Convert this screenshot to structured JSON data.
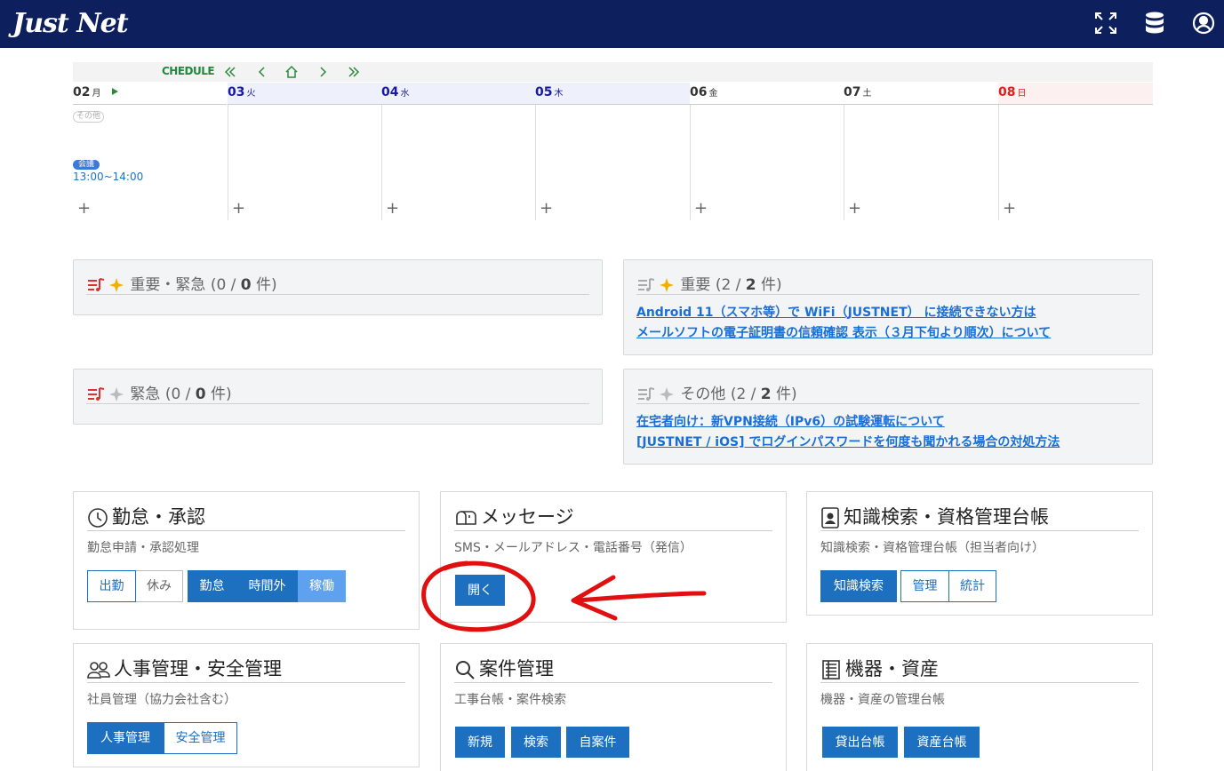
{
  "header": {
    "logo": "Just Net",
    "icons": [
      "fullscreen-icon",
      "database-icon",
      "user-icon"
    ],
    "bg_color": "#0e1f5e"
  },
  "schedule": {
    "title": "CHEDULE",
    "days": [
      {
        "date": "02",
        "dow": "月",
        "color": "#000"
      },
      {
        "date": "03",
        "dow": "火",
        "color": "#1a1aa0"
      },
      {
        "date": "04",
        "dow": "水",
        "color": "#1a1aa0"
      },
      {
        "date": "05",
        "dow": "木",
        "color": "#1a1aa0"
      },
      {
        "date": "06",
        "dow": "金",
        "color": "#000"
      },
      {
        "date": "07",
        "dow": "土",
        "color": "#000"
      },
      {
        "date": "08",
        "dow": "日",
        "color": "#e02020"
      }
    ],
    "other_badge": "その他",
    "meeting_badge": "会議",
    "meeting_time": "13:00~14:00",
    "add_symbol": "+"
  },
  "news": {
    "urgent_important": {
      "label": "重要・緊急",
      "count_open": "(0 / ",
      "count_bold": "0",
      "count_close": " 件)"
    },
    "important": {
      "label": "重要",
      "count_open": "(2 / ",
      "count_bold": "2",
      "count_close": " 件)",
      "links": [
        "Android 11（スマホ等）で WiFi（JUSTNET） に接続できない方は",
        "メールソフトの電子証明書の信頼確認 表示（３月下旬より順次）について"
      ]
    },
    "urgent": {
      "label": "緊急",
      "count_open": "(0 / ",
      "count_bold": "0",
      "count_close": " 件)"
    },
    "other": {
      "label": "その他",
      "count_open": "(2 / ",
      "count_bold": "2",
      "count_close": " 件)",
      "links": [
        "在宅者向け：新VPN接続（IPv6）の試験運転について",
        "[JUSTNET / iOS] でログインパスワードを何度も聞かれる場合の対処方法"
      ]
    }
  },
  "cards": {
    "attendance": {
      "title": "勤怠・承認",
      "sub": "勤怠申請・承認処理",
      "buttons": [
        "出勤",
        "休み",
        "勤怠",
        "時間外",
        "稼働"
      ]
    },
    "message": {
      "title": "メッセージ",
      "sub": "SMS・メールアドレス・電話番号（発信）",
      "buttons": [
        "開く"
      ]
    },
    "knowledge": {
      "title": "知識検索・資格管理台帳",
      "sub": "知識検索・資格管理台帳（担当者向け）",
      "buttons": [
        "知識検索",
        "管理",
        "統計"
      ]
    },
    "hr": {
      "title": "人事管理・安全管理",
      "sub": "社員管理（協力会社含む）",
      "buttons": [
        "人事管理",
        "安全管理"
      ]
    },
    "project": {
      "title": "案件管理",
      "sub": "工事台帳・案件検索",
      "buttons": [
        "新規",
        "検索",
        "自案件"
      ]
    },
    "equipment": {
      "title": "機器・資産",
      "sub": "機器・資産の管理台帳",
      "buttons": [
        "貸出台帳",
        "資産台帳"
      ]
    }
  },
  "colors": {
    "primary": "#1d6fc0",
    "link": "#1a6fd6",
    "annotation": "#e01010"
  }
}
